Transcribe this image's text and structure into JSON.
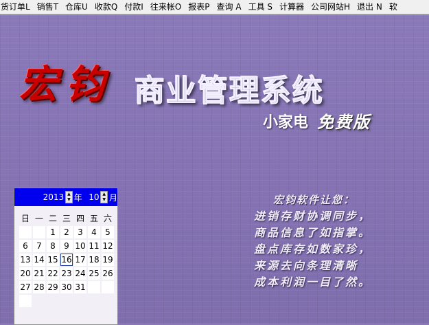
{
  "menu": [
    "货订单L",
    "销售T",
    "仓库U",
    "收款Q",
    "付款I",
    "往来帐O",
    "报表P",
    "查询 A",
    "工具 S",
    "计算器",
    "公司网站H",
    "退出 N",
    "软"
  ],
  "brand": {
    "logo": "宏钧",
    "system_title": "商业管理系统",
    "edition": "小家电",
    "edition_free": "免费版"
  },
  "calendar": {
    "year": "2013",
    "year_label": "年",
    "month": "10",
    "month_label": "月",
    "weekdays": [
      "日",
      "一",
      "二",
      "三",
      "四",
      "五",
      "六"
    ],
    "days": [
      "",
      "",
      "1",
      "2",
      "3",
      "4",
      "5",
      "6",
      "7",
      "8",
      "9",
      "10",
      "11",
      "12",
      "13",
      "14",
      "15",
      "16",
      "17",
      "18",
      "19",
      "20",
      "21",
      "22",
      "23",
      "24",
      "25",
      "26",
      "27",
      "28",
      "29",
      "30",
      "31",
      "",
      "",
      ""
    ],
    "today": "16"
  },
  "slogan": {
    "title": "宏钧软件让您：",
    "lines": [
      "进销存财协调同步，",
      "商品信息了如指掌。",
      "盘点库存如数家珍，",
      "来源去向条理清晰",
      "成本利润一目了然。"
    ]
  }
}
